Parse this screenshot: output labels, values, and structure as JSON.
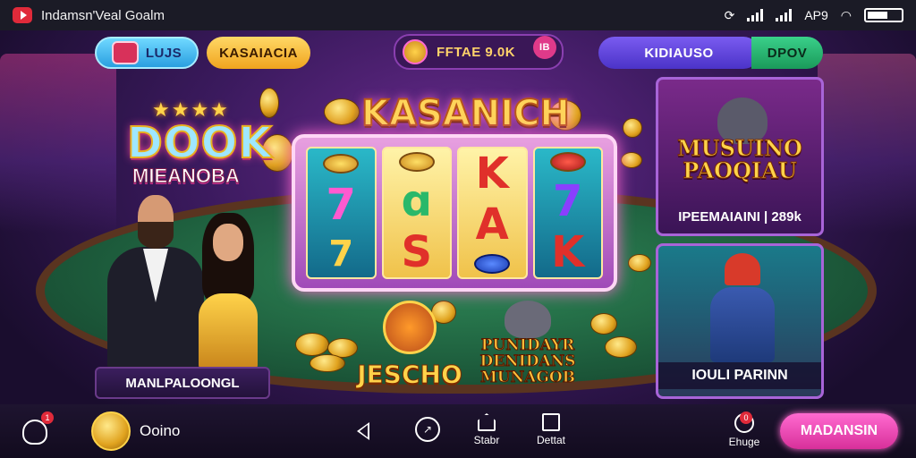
{
  "status_bar": {
    "title": "Indamsn'Veal Goalm",
    "right_text": "AP9"
  },
  "top_bar": {
    "lujs_label": "LUJS",
    "kas_label": "KASAIACIA",
    "prize_label": "FFTAE 9.0K",
    "prize_badge": "IB",
    "kid_label": "KIDIAUSO",
    "dpov_label": "DPOV"
  },
  "left_logo": {
    "stars": "★★★★",
    "title": "DOOK",
    "subtitle": "MIEANOBA"
  },
  "slot": {
    "title": "KASANICH",
    "reels": [
      [
        "7",
        "7"
      ],
      [
        "",
        "S"
      ],
      [
        "K",
        "A"
      ],
      [
        "7",
        "K"
      ]
    ]
  },
  "left_label": "MANLPALOONGL",
  "tiles": {
    "jescho": "JESCHO",
    "pund": "PUNIDAYR DENIDANS MUNAGOB"
  },
  "right_cards": {
    "top_title": "MUSUINO PAOQIAU",
    "top_footer": "IPEEMAIAINI | 289k",
    "bottom_footer": "IOULI PARINN"
  },
  "nav": {
    "home_badge": "1",
    "coin_label": "Ooino",
    "stab_label": "Stabr",
    "det_label": "Dettat",
    "bell_label": "Ehuge",
    "bell_badge": "0",
    "cta_label": "MADANSIN"
  },
  "colors": {
    "accent_pink": "#ff6ad0",
    "accent_gold": "#ffd34a",
    "table_felt": "#2f8a58",
    "background": "#3b1a5e"
  }
}
